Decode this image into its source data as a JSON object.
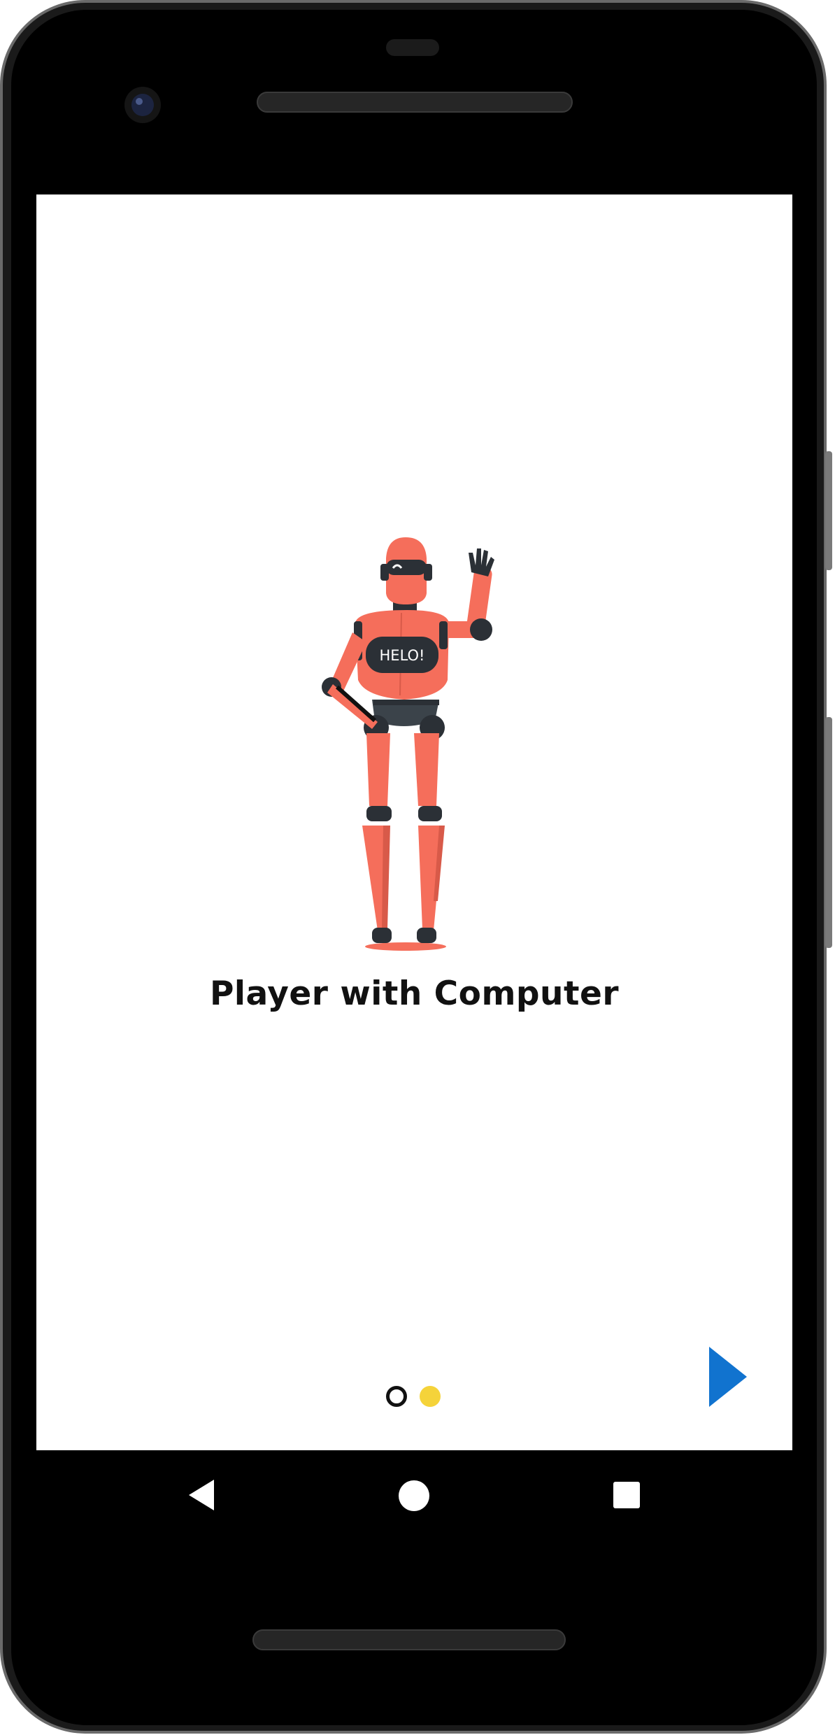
{
  "onboarding": {
    "illustration_text": "HELO!",
    "title": "Player with Computer",
    "pager": {
      "pages": 2,
      "current_page": 2
    },
    "next_icon": "chevron-right-icon"
  },
  "navbar": {
    "back_icon": "back-triangle-icon",
    "home_icon": "home-circle-icon",
    "recents_icon": "recents-square-icon"
  },
  "colors": {
    "robot_body": "#f56e5b",
    "robot_dark": "#2b3036",
    "active_dot": "#f5d33a",
    "next_arrow": "#1173cf"
  }
}
